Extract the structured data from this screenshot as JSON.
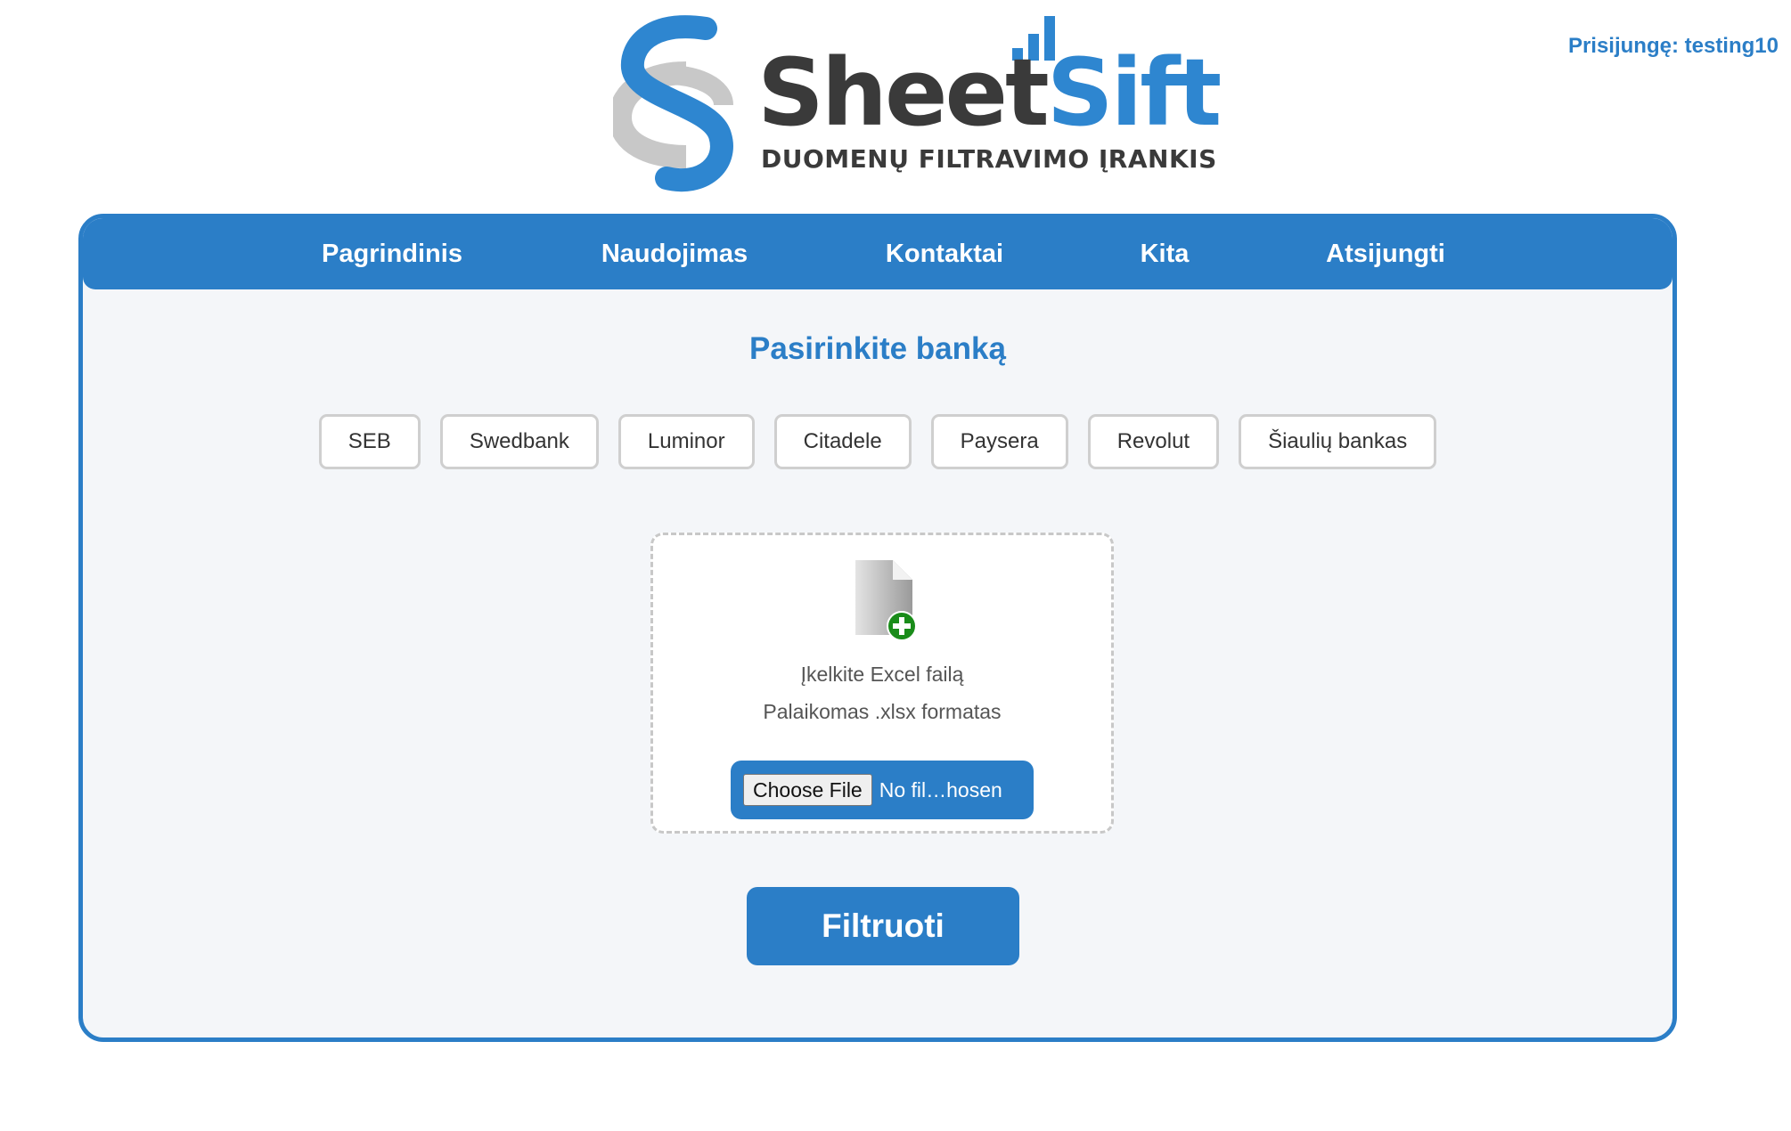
{
  "header": {
    "login_status": "Prisijungę: testing10",
    "logo": {
      "name_part1": "Sheet",
      "name_part2": "Sift",
      "tagline": "DUOMENŲ FILTRAVIMO ĮRANKIS"
    }
  },
  "nav": {
    "items": [
      {
        "label": "Pagrindinis"
      },
      {
        "label": "Naudojimas"
      },
      {
        "label": "Kontaktai"
      },
      {
        "label": "Kita"
      },
      {
        "label": "Atsijungti"
      }
    ]
  },
  "main": {
    "title": "Pasirinkite banką",
    "banks": [
      {
        "label": "SEB"
      },
      {
        "label": "Swedbank"
      },
      {
        "label": "Luminor"
      },
      {
        "label": "Citadele"
      },
      {
        "label": "Paysera"
      },
      {
        "label": "Revolut"
      },
      {
        "label": "Šiaulių bankas"
      }
    ],
    "upload": {
      "icon": "file-add-icon",
      "line1": "Įkelkite Excel failą",
      "line2": "Palaikomas .xlsx formatas",
      "choose_label": "Choose File",
      "file_status": "No fil…hosen"
    },
    "filter_label": "Filtruoti"
  },
  "colors": {
    "accent": "#2b7ec7",
    "logo_blue": "#2e86d0",
    "logo_dark": "#3a3a3a",
    "logo_gray": "#c8c8c8",
    "card_bg": "#f4f6f9",
    "add_green": "#1a8c1a"
  }
}
